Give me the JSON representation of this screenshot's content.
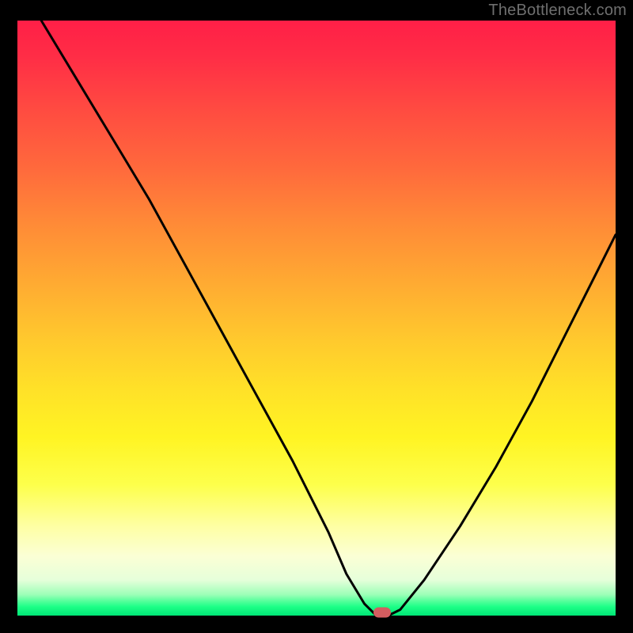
{
  "watermark": "TheBottleneck.com",
  "colors": {
    "frame": "#000000",
    "curve": "#000000",
    "marker": "#d35d60",
    "watermark": "#6f6f6f"
  },
  "chart_data": {
    "type": "line",
    "title": "",
    "xlabel": "",
    "ylabel": "",
    "xlim": [
      0,
      100
    ],
    "ylim": [
      0,
      100
    ],
    "grid": false,
    "legend": false,
    "series": [
      {
        "name": "bottleneck-curve",
        "x": [
          4,
          10,
          16,
          22,
          28,
          34,
          40,
          46,
          52,
          55,
          58,
          60,
          62,
          64,
          68,
          74,
          80,
          86,
          92,
          98,
          100
        ],
        "values": [
          100,
          90,
          80,
          70,
          59,
          48,
          37,
          26,
          14,
          7,
          2,
          0,
          0,
          1,
          6,
          15,
          25,
          36,
          48,
          60,
          64
        ]
      }
    ],
    "annotations": [
      {
        "name": "min-marker",
        "x": 61,
        "y": 0
      }
    ],
    "background_gradient": [
      {
        "stop": 0.0,
        "color": "#ff1f47"
      },
      {
        "stop": 0.5,
        "color": "#ffca2d"
      },
      {
        "stop": 0.8,
        "color": "#fdff60"
      },
      {
        "stop": 0.95,
        "color": "#c8ffc8"
      },
      {
        "stop": 1.0,
        "color": "#00e676"
      }
    ]
  }
}
